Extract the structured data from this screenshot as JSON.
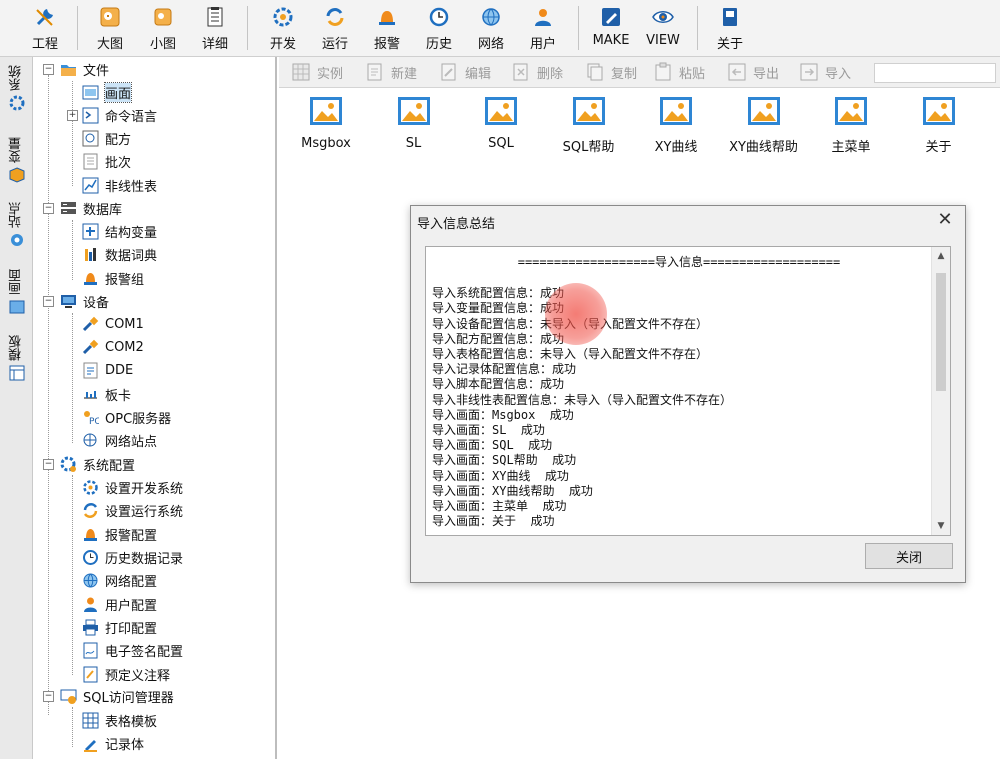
{
  "toolbar": {
    "items": [
      {
        "label": "工程",
        "icon": "wrench-icon"
      },
      {
        "label": "大图",
        "icon": "large-icons-icon"
      },
      {
        "label": "小图",
        "icon": "small-icons-icon"
      },
      {
        "label": "详细",
        "icon": "details-icon"
      },
      {
        "label": "开发",
        "icon": "develop-gear-icon"
      },
      {
        "label": "运行",
        "icon": "run-icon"
      },
      {
        "label": "报警",
        "icon": "alarm-bell-icon"
      },
      {
        "label": "历史",
        "icon": "history-clock-icon"
      },
      {
        "label": "网络",
        "icon": "network-globe-icon"
      },
      {
        "label": "用户",
        "icon": "user-icon"
      },
      {
        "label": "MAKE",
        "icon": "make-pencil-icon"
      },
      {
        "label": "VIEW",
        "icon": "view-eye-icon"
      },
      {
        "label": "关于",
        "icon": "about-book-icon"
      }
    ]
  },
  "side_tabs": [
    "系统",
    "变量",
    "站点",
    "画面",
    "模板"
  ],
  "tree": {
    "file": "文件",
    "file_children": [
      "画面",
      "命令语言",
      "配方",
      "批次",
      "非线性表"
    ],
    "database": "数据库",
    "database_children": [
      "结构变量",
      "数据词典",
      "报警组"
    ],
    "device": "设备",
    "device_children": [
      "COM1",
      "COM2",
      "DDE",
      "板卡",
      "OPC服务器",
      "网络站点"
    ],
    "sysconfig": "系统配置",
    "sysconfig_children": [
      "设置开发系统",
      "设置运行系统",
      "报警配置",
      "历史数据记录",
      "网络配置",
      "用户配置",
      "打印配置",
      "电子签名配置",
      "预定义注释"
    ],
    "sql": "SQL访问管理器",
    "sql_children": [
      "表格模板",
      "记录体"
    ]
  },
  "subtoolbar": [
    "实例",
    "新建",
    "编辑",
    "删除",
    "复制",
    "粘贴",
    "导出",
    "导入"
  ],
  "screens": [
    "Msgbox",
    "SL",
    "SQL",
    "SQL帮助",
    "XY曲线",
    "XY曲线帮助",
    "主菜单",
    "关于"
  ],
  "dialog": {
    "title": "导入信息总结",
    "close_symbol": "✕",
    "header": "===================导入信息===================",
    "lines": [
      "导入系统配置信息：成功",
      "导入变量配置信息：成功",
      "导入设备配置信息：未导入（导入配置文件不存在）",
      "导入配方配置信息：成功",
      "导入表格配置信息：未导入（导入配置文件不存在）",
      "导入记录体配置信息：成功",
      "导入脚本配置信息：成功",
      "导入非线性表配置信息：未导入（导入配置文件不存在）",
      "导入画面：Msgbox  成功",
      "导入画面：SL  成功",
      "导入画面：SQL  成功",
      "导入画面：SQL帮助  成功",
      "导入画面：XY曲线  成功",
      "导入画面：XY曲线帮助  成功",
      "导入画面：主菜单  成功",
      "导入画面：关于  成功"
    ],
    "close_button": "关闭"
  }
}
